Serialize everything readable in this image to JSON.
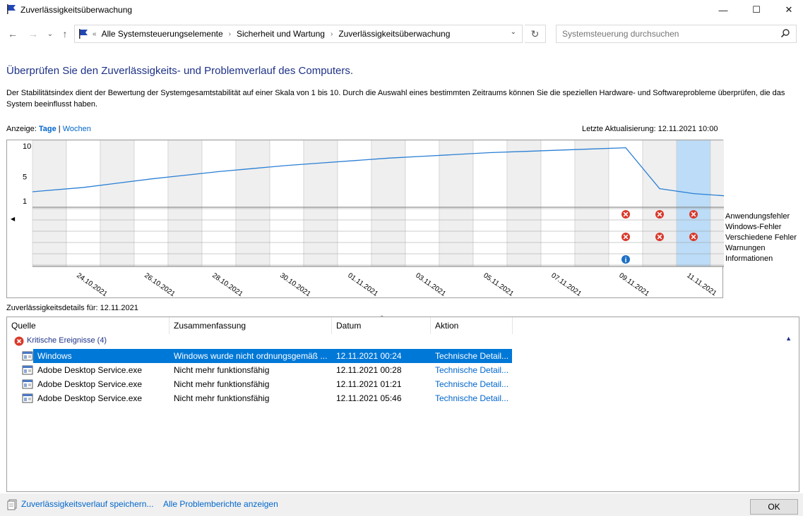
{
  "window": {
    "title": "Zuverlässigkeitsüberwachung",
    "minimize": "—",
    "maximize": "☐",
    "close": "✕"
  },
  "nav": {
    "back": "←",
    "forward": "→",
    "recent": "⌄",
    "up": "↑",
    "breadcrumbs": [
      "Alle Systemsteuerungselemente",
      "Sicherheit und Wartung",
      "Zuverlässigkeitsüberwachung"
    ],
    "search_placeholder": "Systemsteuerung durchsuchen"
  },
  "heading": "Überprüfen Sie den Zuverlässigkeits- und Problemverlauf des Computers.",
  "description": "Der Stabilitätsindex dient der Bewertung der Systemgesamtstabilität auf einer Skala von 1 bis 10. Durch die Auswahl eines bestimmten Zeitraums können Sie die speziellen Hardware- und Softwareprobleme überprüfen, die das System beeinflusst haben.",
  "view": {
    "label": "Anzeige:",
    "days": "Tage",
    "separator": "|",
    "weeks": "Wochen"
  },
  "last_update": "Letzte Aktualisierung: 12.11.2021 10:00",
  "chart_data": {
    "type": "line",
    "ylim": [
      1,
      10
    ],
    "yticks": [
      "10",
      "5",
      "1"
    ],
    "date_labels": [
      "24.10.2021",
      "26.10.2021",
      "28.10.2021",
      "30.10.2021",
      "01.11.2021",
      "03.11.2021",
      "05.11.2021",
      "07.11.2021",
      "09.11.2021",
      "11.11.2021"
    ],
    "x": [
      "23.10.2021",
      "24.10.2021",
      "25.10.2021",
      "26.10.2021",
      "27.10.2021",
      "28.10.2021",
      "29.10.2021",
      "30.10.2021",
      "31.10.2021",
      "01.11.2021",
      "02.11.2021",
      "03.11.2021",
      "04.11.2021",
      "05.11.2021",
      "06.11.2021",
      "07.11.2021",
      "08.11.2021",
      "09.11.2021",
      "10.11.2021",
      "11.11.2021",
      "12.11.2021"
    ],
    "stability": [
      2.5,
      3.2,
      3.9,
      4.6,
      5.2,
      5.8,
      6.3,
      6.8,
      7.2,
      7.6,
      8.0,
      8.3,
      8.6,
      8.9,
      9.1,
      9.3,
      9.5,
      9.7,
      3.0,
      2.2,
      1.8
    ],
    "selected_index": 19,
    "event_rows": [
      "Anwendungsfehler",
      "Windows-Fehler",
      "Verschiedene Fehler",
      "Warnungen",
      "Informationen"
    ],
    "events": [
      {
        "date_index": 17,
        "row": 0,
        "kind": "error"
      },
      {
        "date_index": 18,
        "row": 0,
        "kind": "error"
      },
      {
        "date_index": 19,
        "row": 0,
        "kind": "error"
      },
      {
        "date_index": 17,
        "row": 2,
        "kind": "error"
      },
      {
        "date_index": 18,
        "row": 2,
        "kind": "error"
      },
      {
        "date_index": 19,
        "row": 2,
        "kind": "error"
      },
      {
        "date_index": 17,
        "row": 4,
        "kind": "info"
      }
    ]
  },
  "legend": [
    "Anwendungsfehler",
    "Windows-Fehler",
    "Verschiedene Fehler",
    "Warnungen",
    "Informationen"
  ],
  "details_label": "Zuverlässigkeitsdetails für: 12.11.2021",
  "table": {
    "columns": [
      "Quelle",
      "Zusammenfassung",
      "Datum",
      "Aktion"
    ],
    "group": "Kritische Ereignisse (4)",
    "rows": [
      {
        "source": "Windows",
        "summary": "Windows wurde nicht ordnungsgemäß ...",
        "date": "12.11.2021 00:24",
        "action": "Technische Detail...",
        "selected": true
      },
      {
        "source": "Adobe Desktop Service.exe",
        "summary": "Nicht mehr funktionsfähig",
        "date": "12.11.2021 00:28",
        "action": "Technische Detail...",
        "selected": false
      },
      {
        "source": "Adobe Desktop Service.exe",
        "summary": "Nicht mehr funktionsfähig",
        "date": "12.11.2021 01:21",
        "action": "Technische Detail...",
        "selected": false
      },
      {
        "source": "Adobe Desktop Service.exe",
        "summary": "Nicht mehr funktionsfähig",
        "date": "12.11.2021 05:46",
        "action": "Technische Detail...",
        "selected": false
      }
    ]
  },
  "footer": {
    "save_history": "Zuverlässigkeitsverlauf speichern...",
    "show_reports": "Alle Problemberichte anzeigen",
    "ok": "OK"
  }
}
